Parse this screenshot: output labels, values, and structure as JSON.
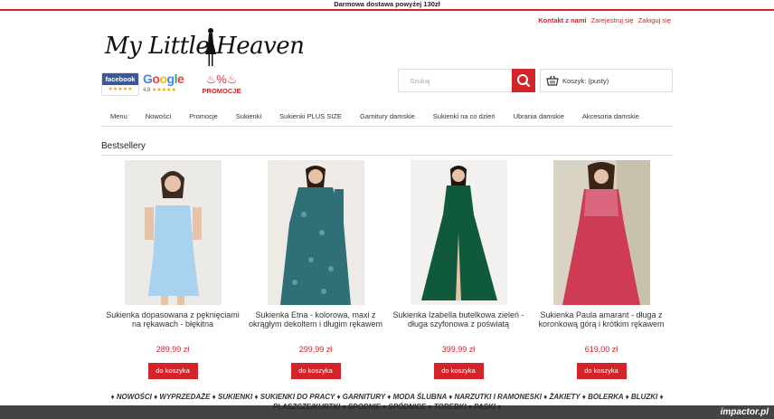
{
  "topbar": {
    "text": "Darmowa dostawa powyżej 130zł"
  },
  "header": {
    "links": [
      "Kontakt z nami",
      "Zarejestruj się",
      "Zaloguj się"
    ],
    "logo_text": "My Little Heaven",
    "badges": {
      "facebook": "facebook",
      "google": "Google",
      "google_rating": "4,8",
      "promo_label": "PROMOCJE"
    },
    "search": {
      "placeholder": "Szukaj"
    },
    "cart": {
      "label": "Koszyk: (pusty)"
    }
  },
  "nav": {
    "items": [
      "Menu",
      "Nowości",
      "Promocje",
      "Sukienki",
      "Sukienki PLUS SIZE",
      "Garnitury damskie",
      "Sukienki na co dzień",
      "Ubrania damskie",
      "Akcesoria damskie"
    ]
  },
  "section": {
    "title": "Bestsellery"
  },
  "products": [
    {
      "name": "Sukienka dopasowana z pęknięciami na rękawach - błękitna",
      "price": "289,99 zł",
      "button": "do koszyka",
      "color": "#a9d2ef"
    },
    {
      "name": "Sukienka Etna - kolorowa, maxi z okrągłym dekoltem i długim rękawem",
      "price": "299,99 zł",
      "button": "do koszyka",
      "color": "#2f6f78"
    },
    {
      "name": "Sukienka Izabella butelkowa zieleń - długa szyfonowa z poświatą",
      "price": "399,99 zł",
      "button": "do koszyka",
      "color": "#0f5a3c"
    },
    {
      "name": "Sukienka Paula amarant - długa z koronkową górą i krótkim rękawem",
      "price": "619,00 zł",
      "button": "do koszyka",
      "color": "#cf3a55"
    }
  ],
  "footer": {
    "links": [
      "NOWOŚCI",
      "WYPRZEDAŻE",
      "SUKIENKI",
      "SUKIENKI DO PRACY",
      "GARNITURY",
      "MODA ŚLUBNA",
      "NARZUTKI I RAMONESKI",
      "ŻAKIETY",
      "BOLERKA",
      "BLUZKI",
      "PŁASZCZE/KURTKI",
      "SPODNIE",
      "SPÓDNICE",
      "TOREBKI",
      "PASKI"
    ]
  },
  "watermark": "impactor.pl",
  "colors": {
    "accent": "#d3242a"
  }
}
